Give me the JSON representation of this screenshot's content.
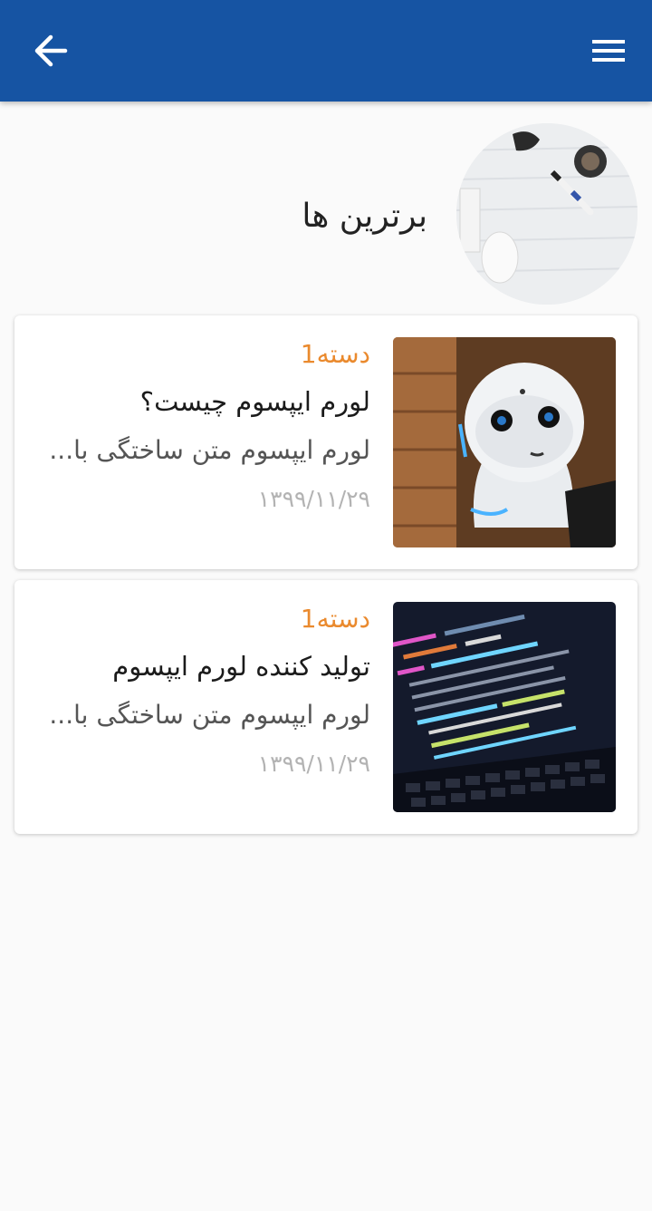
{
  "appbar": {
    "back_icon": "arrow-back-icon",
    "menu_icon": "hamburger-menu-icon",
    "background_color": "#1654a3"
  },
  "header": {
    "title": "برترین ها",
    "image": "desk-flatlay-photo"
  },
  "articles": [
    {
      "category": "دسته1",
      "title": "لورم ایپسوم چیست؟",
      "excerpt": "لورم ایپسوم متن ساختگی با...",
      "date": "۱۳۹۹/۱۱/۲۹",
      "image": "robot-photo"
    },
    {
      "category": "دسته1",
      "title": "تولید کننده لورم ایپسوم",
      "excerpt": "لورم ایپسوم متن ساختگی با...",
      "date": "۱۳۹۹/۱۱/۲۹",
      "image": "code-laptop-photo"
    }
  ],
  "colors": {
    "category": "#ea8a2e",
    "date": "#b3b3b3"
  }
}
